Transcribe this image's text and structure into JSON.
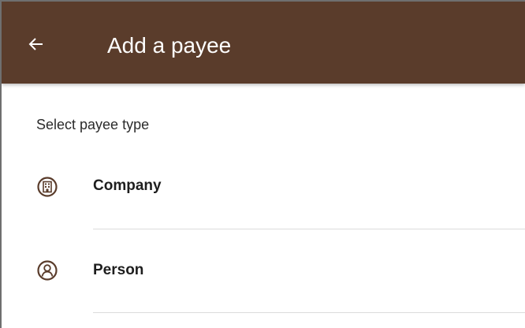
{
  "appbar": {
    "title": "Add a payee",
    "back_icon": "arrow-left-icon",
    "background_color": "#5a3c2b",
    "text_color": "#ffffff"
  },
  "section": {
    "label": "Select payee type"
  },
  "options": [
    {
      "label": "Company",
      "icon": "building-icon"
    },
    {
      "label": "Person",
      "icon": "person-icon"
    }
  ]
}
